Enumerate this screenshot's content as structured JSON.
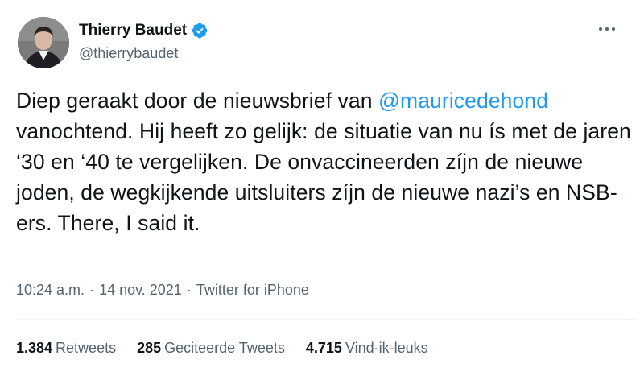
{
  "author": {
    "display_name": "Thierry Baudet",
    "handle": "@thierrybaudet",
    "verified": true
  },
  "tweet": {
    "segments": [
      {
        "type": "text",
        "value": "Diep geraakt door de nieuwsbrief van "
      },
      {
        "type": "mention",
        "value": "@mauricedehond"
      },
      {
        "type": "text",
        "value": " vanochtend. Hij heeft zo gelijk: de situatie van nu ís met de jaren ‘30 en ‘40 te vergelijken. De onvaccineerden zíjn de nieuwe joden, de wegkijkende uitsluiters zíjn de nieuwe nazi’s en NSB-ers. There, I said it."
      }
    ]
  },
  "meta": {
    "time": "10:24 a.m.",
    "separator1": "·",
    "date": "14 nov. 2021",
    "separator2": "·",
    "source": "Twitter for iPhone"
  },
  "stats": {
    "retweets_count": "1.384",
    "retweets_label": "Retweets",
    "quotes_count": "285",
    "quotes_label": "Geciteerde Tweets",
    "likes_count": "4.715",
    "likes_label": "Vind-ik-leuks"
  },
  "colors": {
    "accent": "#1d9bf0",
    "text": "#0f1419",
    "secondary": "#536471"
  },
  "icons": {
    "verified": "verified-badge-icon",
    "more": "more-options-icon"
  }
}
